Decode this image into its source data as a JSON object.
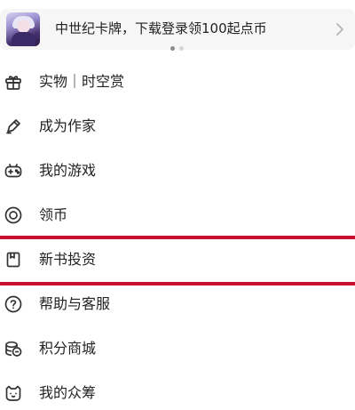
{
  "banner": {
    "text": "中世纪卡牌，下载登录领100起点币",
    "carousel_pages": 2,
    "carousel_active": 1
  },
  "menu": {
    "items": [
      {
        "label": "实物｜时空赏",
        "icon": "gift-icon"
      },
      {
        "label": "成为作家",
        "icon": "pen-icon"
      },
      {
        "label": "我的游戏",
        "icon": "gamepad-icon"
      },
      {
        "label": "领币",
        "icon": "coin-icon"
      },
      {
        "label": "新书投资",
        "icon": "bookmark-icon"
      },
      {
        "label": "帮助与客服",
        "icon": "help-icon"
      },
      {
        "label": "积分商城",
        "icon": "points-icon"
      },
      {
        "label": "我的众筹",
        "icon": "crowdfund-cat-icon"
      }
    ]
  },
  "colors": {
    "highlight": "#c8102e",
    "banner_bg": "#f6f6f6",
    "text": "#222222",
    "icon": "#333333"
  }
}
